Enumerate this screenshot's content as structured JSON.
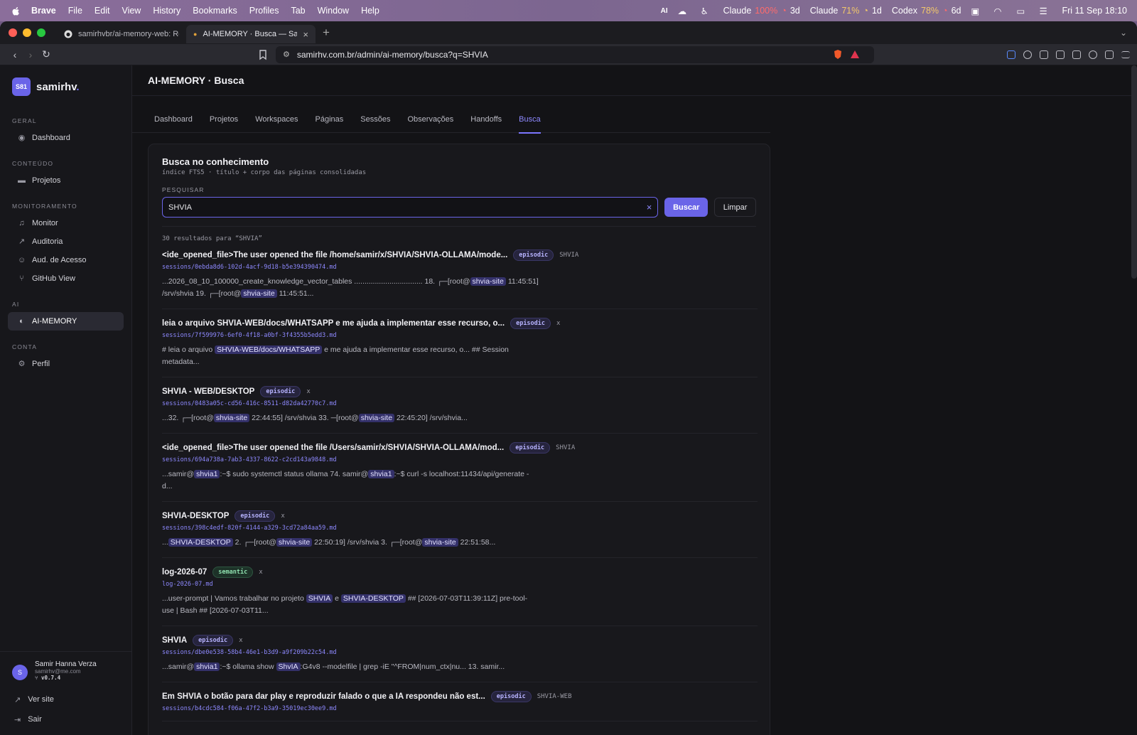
{
  "menubar": {
    "app": "Brave",
    "items": [
      "File",
      "Edit",
      "View",
      "History",
      "Bookmarks",
      "Profiles",
      "Tab",
      "Window",
      "Help"
    ],
    "status": {
      "ai": "AI",
      "claude1_label": "Claude",
      "claude1_pct": "100%",
      "claude1_time": "3d",
      "claude2_label": "Claude",
      "claude2_pct": "71%",
      "claude2_time": "1d",
      "codex_label": "Codex",
      "codex_pct": "78%",
      "codex_time": "6d",
      "clock": "Fri 11 Sep  18:10"
    }
  },
  "browser": {
    "tabs": [
      {
        "title": "samirhvbr/ai-memory-web: Read-o",
        "icon": "github-icon"
      },
      {
        "title": "AI-MEMORY · Busca — Samirh",
        "icon": "site-dot-icon"
      }
    ],
    "url": "samirhv.com.br/admin/ai-memory/busca?q=SHVIA"
  },
  "sidebar": {
    "logo": "S81",
    "brand": "samirhv",
    "brand_dot": ".",
    "sections": {
      "geral": "GERAL",
      "conteudo": "CONTEÚDO",
      "monitoramento": "MONITORAMENTO",
      "ai": "AI",
      "conta": "CONTA"
    },
    "items": {
      "dashboard": "Dashboard",
      "projetos": "Projetos",
      "monitor": "Monitor",
      "auditoria": "Auditoria",
      "aud_acesso": "Aud. de Acesso",
      "github_view": "GitHub View",
      "ai_memory": "AI-MEMORY",
      "perfil": "Perfil"
    },
    "user": {
      "initial": "S",
      "name": "Samir Hanna Verza",
      "email": "samirhv@me.com",
      "version": "v0.7.4"
    },
    "ver_site": "Ver site",
    "sair": "Sair"
  },
  "page": {
    "title": "AI-MEMORY · Busca",
    "tabs": [
      "Dashboard",
      "Projetos",
      "Workspaces",
      "Páginas",
      "Sessões",
      "Observações",
      "Handoffs",
      "Busca"
    ],
    "active_tab": "Busca"
  },
  "search": {
    "heading": "Busca no conhecimento",
    "subtitle": "índice FTS5 · título + corpo das páginas consolidadas",
    "label": "PESQUISAR",
    "value": "SHVIA",
    "submit": "Buscar",
    "clear": "Limpar",
    "count": "30 resultados para “SHVIA”"
  },
  "results": [
    {
      "title": "<ide_opened_file>The user opened the file /home/samir/x/SHVIA/SHVIA-OLLAMA/mode...",
      "tag": "episodic",
      "project": "SHVIA",
      "path": "sessions/0ebda8d6-102d-4acf-9d18-b5e394390474.md",
      "s1": "...2026_08_10_100000_create_knowledge_vector_tables ................................. 18.  ┌─[root@",
      "h1": "shvia-site",
      "s2": " 11:45:51] /srv/shvia 19.  ┌─[root@",
      "h2": "shvia-site",
      "s3": " 11:45:51..."
    },
    {
      "title": "leia o arquivo SHVIA-WEB/docs/WHATSAPP e me ajuda a implementar esse recurso, o...",
      "tag": "episodic",
      "project": "x",
      "path": "sessions/7f599976-6ef0-4f18-a0bf-3f4355b5edd3.md",
      "s1": "# leia o arquivo ",
      "h1": "SHVIA-WEB/docs/WHATSAPP",
      "s2": " e me ajuda a implementar esse recurso, o... ## Session metadata..."
    },
    {
      "title": "SHVIA - WEB/DESKTOP",
      "tag": "episodic",
      "project": "x",
      "path": "sessions/0483a05c-cd56-416c-8511-d82da42770c7.md",
      "s1": "...32.  ┌─[root@",
      "h1": "shvia-site",
      "s2": " 22:44:55] /srv/shvia 33. ─[root@",
      "h2": "shvia-site",
      "s3": " 22:45:20] /srv/shvia..."
    },
    {
      "title": "<ide_opened_file>The user opened the file /Users/samir/x/SHVIA/SHVIA-OLLAMA/mod...",
      "tag": "episodic",
      "project": "SHVIA",
      "path": "sessions/694a738a-7ab3-4337-8622-c2cd143a9848.md",
      "s1": "...samir@",
      "h1": "shvia1",
      "s2": ":~$ sudo systemctl status ollama 74. samir@",
      "h2": "shvia1",
      "s3": ":~$ curl -s localhost:11434/api/generate -d..."
    },
    {
      "title": "SHVIA-DESKTOP",
      "tag": "episodic",
      "project": "x",
      "path": "sessions/398c4edf-820f-4144-a329-3cd72a84aa59.md",
      "s1": "...",
      "h1": "SHVIA-DESKTOP",
      "s2": " 2.  ┌─[root@",
      "h2": "shvia-site",
      "s3": " 22:50:19] /srv/shvia 3.  ┌─[root@",
      "h3": "shvia-site",
      "s4": " 22:51:58..."
    },
    {
      "title": "log-2026-07",
      "tag": "semantic",
      "project": "x",
      "path": "log-2026-07.md",
      "s1": "...user-prompt | Vamos trabalhar no projeto ",
      "h1": "SHVIA",
      "s2": " e ",
      "h2": "SHVIA-DESKTOP",
      "s3": " ## [2026-07-03T11:39:11Z] pre-tool-use | Bash ## [2026-07-03T11..."
    },
    {
      "title": "SHVIA",
      "tag": "episodic",
      "project": "x",
      "path": "sessions/dbe0e538-58b4-46e1-b3d9-a9f209b22c54.md",
      "s1": "...samir@",
      "h1": "shvia1",
      "s2": ":~$ ollama show ",
      "h2": "ShvIA",
      "s3": ":G4v8 --modelfile | grep -iE \"^FROM|num_ctx|nu... 13. samir..."
    },
    {
      "title": "Em SHVIA o botão para dar play e reproduzir falado o que a IA respondeu não est...",
      "tag": "episodic",
      "project": "SHVIA-WEB",
      "path": "sessions/b4cdc584-f06a-47f2-b3a9-35019ec30ee9.md"
    }
  ],
  "colors": {
    "accent": "#6a64e8",
    "accent_text": "#8e89ff",
    "background": "#131316",
    "sidebar": "#17171b",
    "card": "#18181c"
  }
}
